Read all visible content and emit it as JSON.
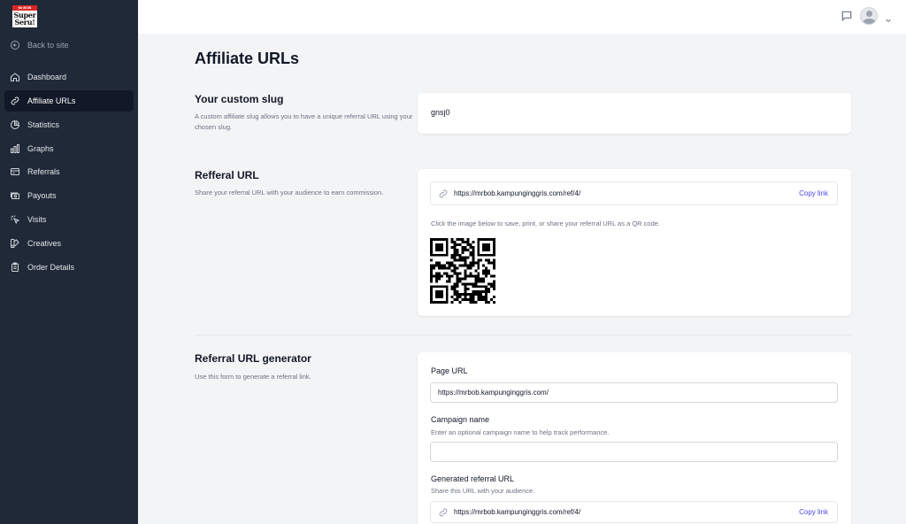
{
  "logo": {
    "top_text": "Mr.BOB",
    "line1": "Super",
    "line2": "Seru!"
  },
  "sidebar": {
    "back_label": "Back to site",
    "items": [
      {
        "label": "Dashboard",
        "icon": "home-icon"
      },
      {
        "label": "Affiliate URLs",
        "icon": "link-icon",
        "active": true
      },
      {
        "label": "Statistics",
        "icon": "pie-chart-icon"
      },
      {
        "label": "Graphs",
        "icon": "bar-chart-icon"
      },
      {
        "label": "Referrals",
        "icon": "credit-card-icon"
      },
      {
        "label": "Payouts",
        "icon": "cash-icon"
      },
      {
        "label": "Visits",
        "icon": "cursor-click-icon"
      },
      {
        "label": "Creatives",
        "icon": "color-swatch-icon"
      },
      {
        "label": "Order Details",
        "icon": "clipboard-icon"
      }
    ]
  },
  "header": {
    "title": "Affiliate URLs"
  },
  "slug_section": {
    "title": "Your custom slug",
    "description": "A custom affiliate slug allows you to have a unique referral URL using your chosen slug.",
    "value": "gnsj0"
  },
  "referral_section": {
    "title": "Refferal URL",
    "description": "Share your referral URL with your audience to earn commission.",
    "url": "https://mrbob.kampunginggris.com/ref/4/",
    "copy_label": "Copy link",
    "qr_hint": "Click the image below to save, print, or share your referral URL as a QR code."
  },
  "generator_section": {
    "title": "Referral URL generator",
    "description": "Use this form to generate a referral link.",
    "page_url_label": "Page URL",
    "page_url_value": "https://mrbob.kampunginggris.com/",
    "campaign_label": "Campaign name",
    "campaign_help": "Enter an optional campaign name to help track performance.",
    "campaign_value": "",
    "generated_label": "Generated referral URL",
    "generated_help": "Share this URL with your audience.",
    "generated_url": "https://mrbob.kampunginggris.com/ref/4/",
    "copy_label": "Copy link"
  },
  "colors": {
    "sidebar_bg": "#1f2937",
    "active_bg": "#111827",
    "page_bg": "#f3f4f6",
    "accent": "#4f46e5"
  }
}
